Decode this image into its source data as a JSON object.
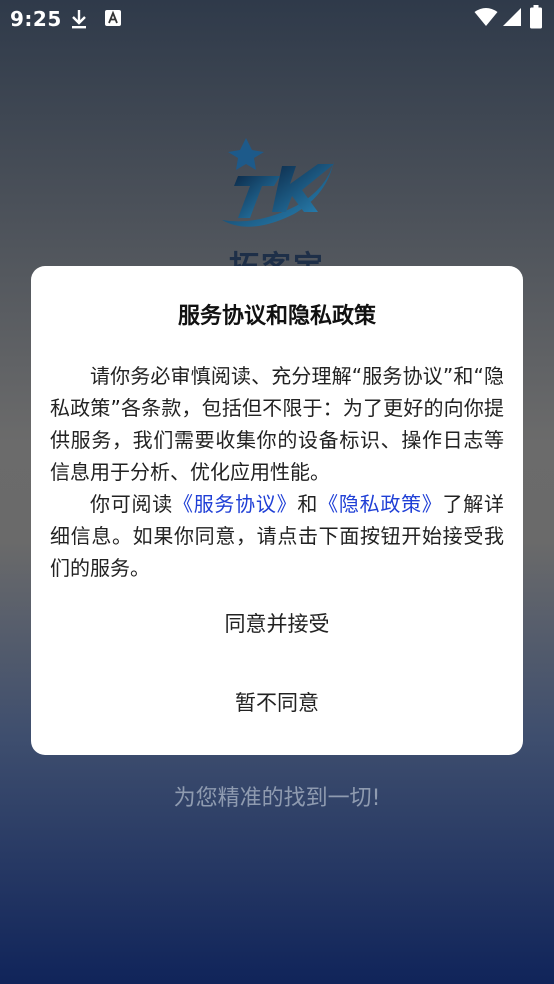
{
  "status_bar": {
    "time": "9:25",
    "icons": [
      "download-icon",
      "a-notification-icon",
      "wifi-icon",
      "signal-icon",
      "battery-icon"
    ]
  },
  "splash": {
    "app_name": "拓客宝",
    "tagline": "为您精准的找到一切!"
  },
  "dialog": {
    "title": "服务协议和隐私政策",
    "para1": "请你务必审慎阅读、充分理解“服务协议”和“隐私政策”各条款，包括但不限于：为了更好的向你提供服务，我们需要收集你的设备标识、操作日志等信息用于分析、优化应用性能。",
    "para2_prefix": "你可阅读",
    "service_link": "《服务协议》",
    "para2_and": "和",
    "privacy_link": "《隐私政策》",
    "para2_suffix": "了解详细信息。如果你同意，请点击下面按钮开始接受我们的服务。",
    "agree_button": "同意并接受",
    "disagree_button": "暂不同意"
  },
  "colors": {
    "link": "#1f3fd6",
    "dialog_bg": "#ffffff",
    "logo_blue": "#1d5a8a"
  }
}
